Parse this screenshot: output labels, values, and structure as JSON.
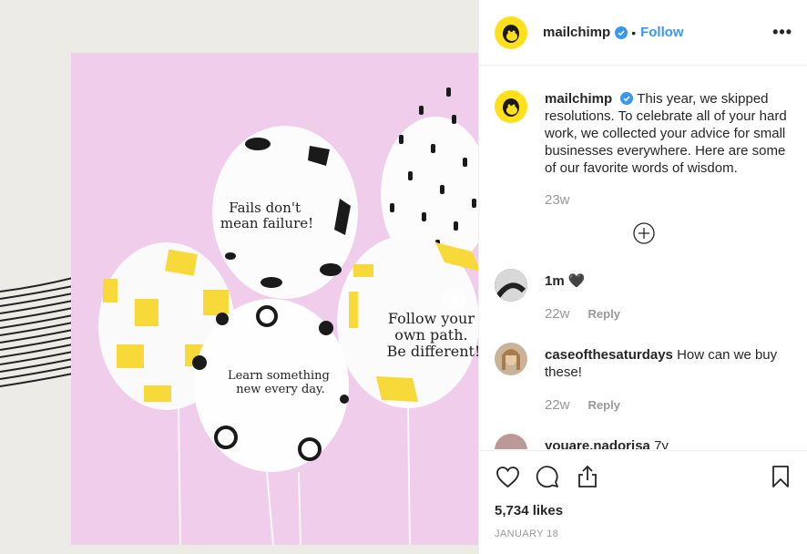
{
  "header": {
    "username": "mailchimp",
    "dot": "•",
    "follow_label": "Follow",
    "more_label": "•••"
  },
  "caption": {
    "username": "mailchimp",
    "text": "This year, we skipped resolutions. To celebrate all of your hard work, we collected your advice for small businesses everywhere. Here are some of our favorite words of wisdom.",
    "time": "23w"
  },
  "comments": [
    {
      "username": "1m",
      "text": "🖤",
      "time": "22w",
      "reply_label": "Reply"
    },
    {
      "username": "caseofthesaturdays",
      "text": "How can we buy these!",
      "time": "22w",
      "reply_label": "Reply"
    },
    {
      "username": "youare.nadorisa",
      "text": "7y",
      "time": "",
      "reply_label": ""
    }
  ],
  "balloons": {
    "b1": [
      "Fails don't",
      "mean failure!"
    ],
    "b2": [
      "Follow your",
      "own path.",
      "Be different!"
    ],
    "b3": [
      "Learn something",
      "new every day."
    ]
  },
  "actions": {
    "likes": "5,734 likes",
    "date": "JANUARY 18"
  },
  "colors": {
    "brand_yellow": "#ffe01b",
    "link_blue": "#3897f0",
    "verified_blue": "#3897f0",
    "balloon_bg": "#f0cdea"
  }
}
